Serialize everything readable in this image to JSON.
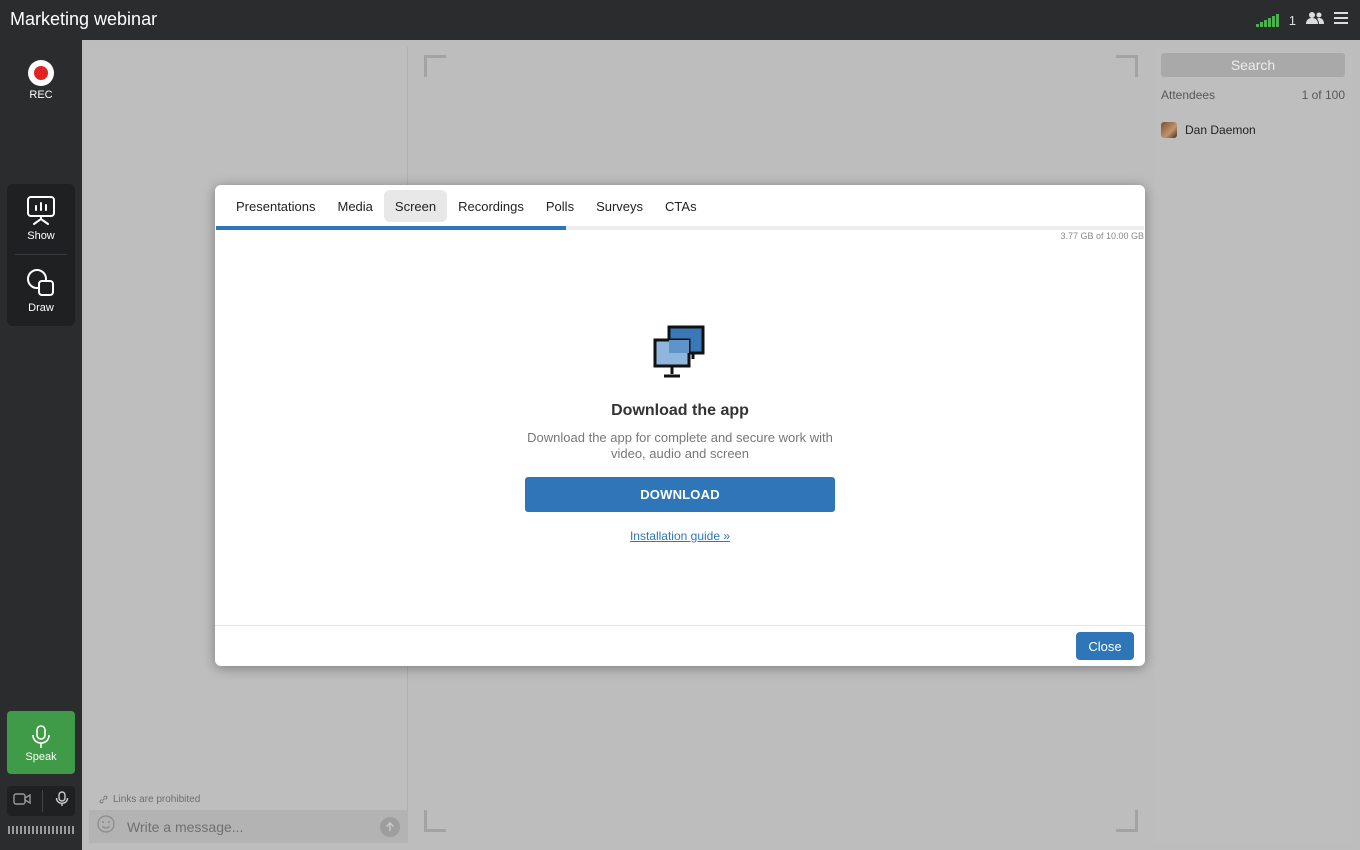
{
  "app": {
    "title": "Marketing webinar",
    "participant_count": "1"
  },
  "rail": {
    "rec_label": "REC",
    "show_label": "Show",
    "draw_label": "Draw",
    "speak_label": "Speak"
  },
  "chat": {
    "links_note": "Links are prohibited",
    "input_placeholder": "Write a message..."
  },
  "attendees": {
    "search_placeholder": "Search",
    "header_label": "Attendees",
    "header_count": "1 of 100",
    "list": [
      {
        "name": "Dan Daemon"
      }
    ]
  },
  "modal": {
    "tabs": [
      {
        "label": "Presentations"
      },
      {
        "label": "Media"
      },
      {
        "label": "Screen",
        "active": true
      },
      {
        "label": "Recordings"
      },
      {
        "label": "Polls"
      },
      {
        "label": "Surveys"
      },
      {
        "label": "CTAs"
      }
    ],
    "storage_text": "3.77 GB of 10.00 GB",
    "storage_used_fraction": 0.377,
    "title": "Download the app",
    "description": "Download the app for complete and secure work with video, audio and screen",
    "download_label": "DOWNLOAD",
    "guide_link": "Installation guide »",
    "close_label": "Close"
  },
  "colors": {
    "accent": "#2f76b9",
    "speak": "#3f9b48",
    "rec": "#e02424",
    "signal": "#4caf50"
  }
}
